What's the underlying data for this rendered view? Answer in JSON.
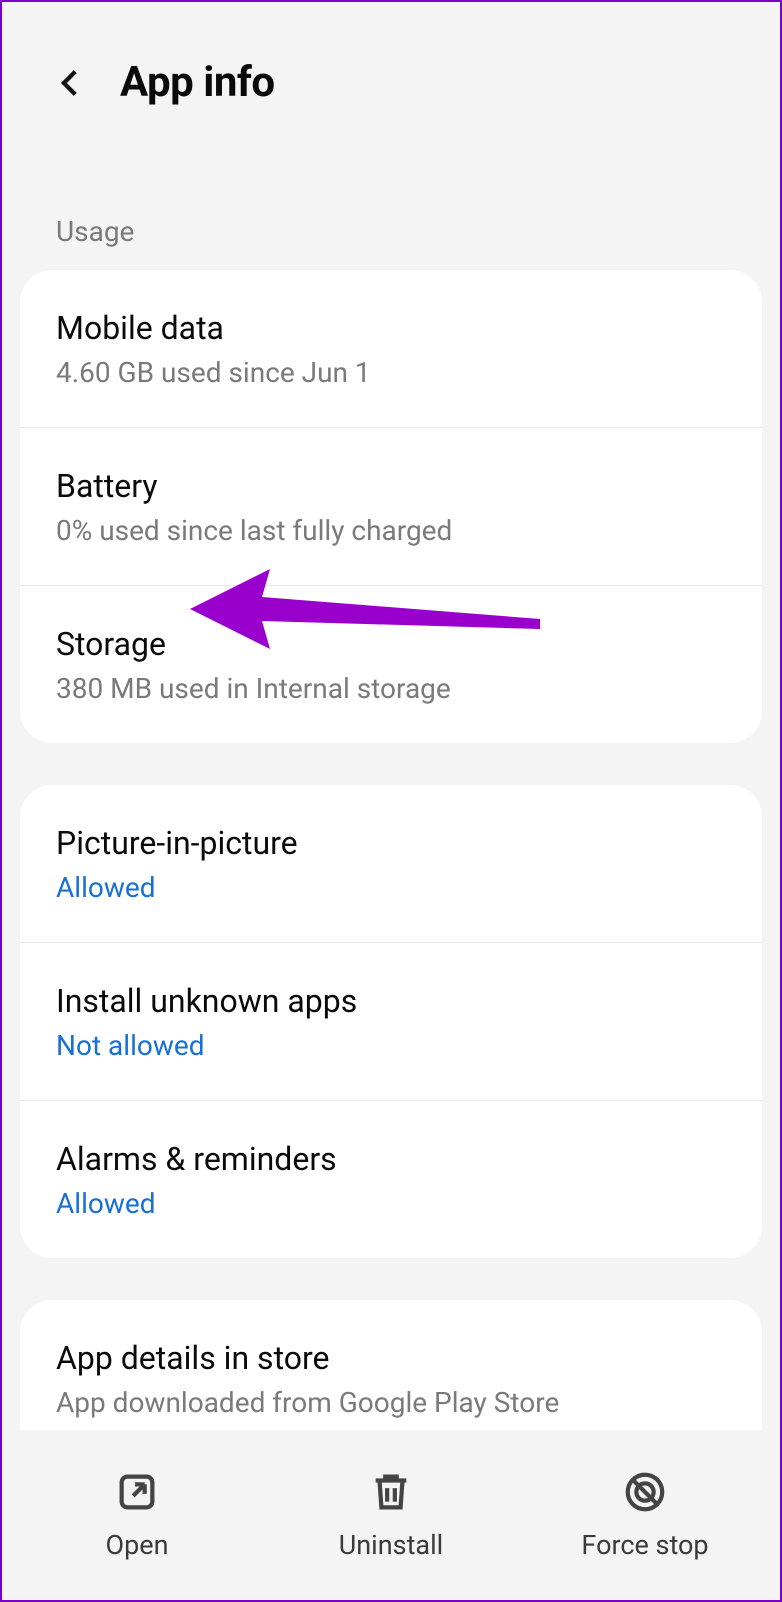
{
  "header": {
    "title": "App info"
  },
  "section_label": "Usage",
  "usage": {
    "rows": [
      {
        "title": "Mobile data",
        "sub": "4.60 GB used since Jun 1"
      },
      {
        "title": "Battery",
        "sub": "0% used since last fully charged"
      },
      {
        "title": "Storage",
        "sub": "380 MB used in Internal storage"
      }
    ]
  },
  "permissions": {
    "rows": [
      {
        "title": "Picture-in-picture",
        "status": "Allowed"
      },
      {
        "title": "Install unknown apps",
        "status": "Not allowed"
      },
      {
        "title": "Alarms & reminders",
        "status": "Allowed"
      }
    ]
  },
  "store": {
    "title": "App details in store",
    "sub": "App downloaded from Google Play Store"
  },
  "bottom_bar": {
    "open": "Open",
    "uninstall": "Uninstall",
    "force_stop": "Force stop"
  },
  "annotation": {
    "arrow_color": "#9900cc"
  }
}
